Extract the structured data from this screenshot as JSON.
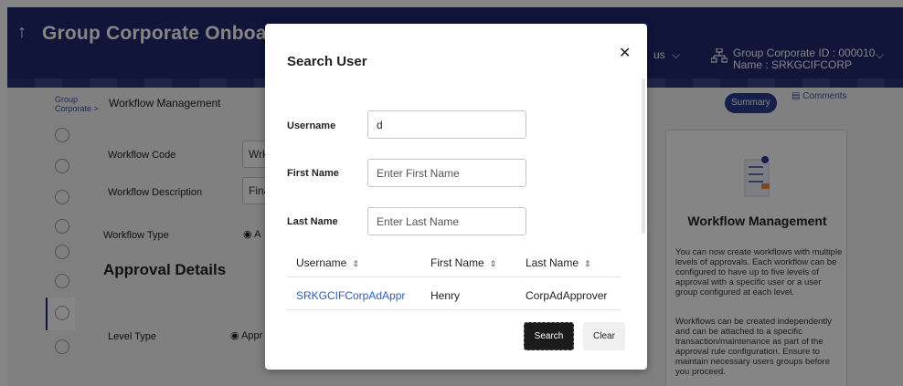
{
  "header": {
    "back_icon": "back-arrow-icon",
    "title": "Group Corporate Onboardi",
    "partial_text": "us",
    "corp_id": "Group Corporate ID : 000010",
    "name": "Name : SRKGCIFCORP"
  },
  "breadcrumb": {
    "parent": "Group Corporate >",
    "current": "Workflow Management"
  },
  "actions": {
    "summary": "Summary",
    "comments": "Comments"
  },
  "form": {
    "workflow_code_label": "Workflow Code",
    "workflow_code_value": "Wrk",
    "workflow_description_label": "Workflow Description",
    "workflow_description_value": "Fina",
    "workflow_type_label": "Workflow Type",
    "workflow_type_option": "A",
    "approval_heading": "Approval Details",
    "level_type_label": "Level Type",
    "level_type_option": "Appr"
  },
  "info_card": {
    "title": "Workflow Management",
    "para1": "You can now create workflows with multiple levels of approvals. Each workflow can be configured to have up to five levels of approval with a specific user or a user group configured at each level.",
    "para2": "Workflows can be created independently and can be attached to a specific transaction/maintenance as part of the approval rule configuration. Ensure to maintain necessary users groups before you proceed."
  },
  "modal": {
    "title": "Search User",
    "close_label": "✕",
    "username_label": "Username",
    "username_value": "d",
    "first_name_label": "First Name",
    "first_name_placeholder": "Enter First Name",
    "last_name_label": "Last Name",
    "last_name_placeholder": "Enter Last Name",
    "columns": [
      "Username",
      "First Name",
      "Last Name"
    ],
    "sort_icon": "⇕",
    "rows": [
      {
        "username": "SRKGCIFCorpAdAppr",
        "first_name": "Henry",
        "last_name": "CorpAdApprover"
      }
    ],
    "search_button": "Search",
    "clear_button": "Clear"
  }
}
